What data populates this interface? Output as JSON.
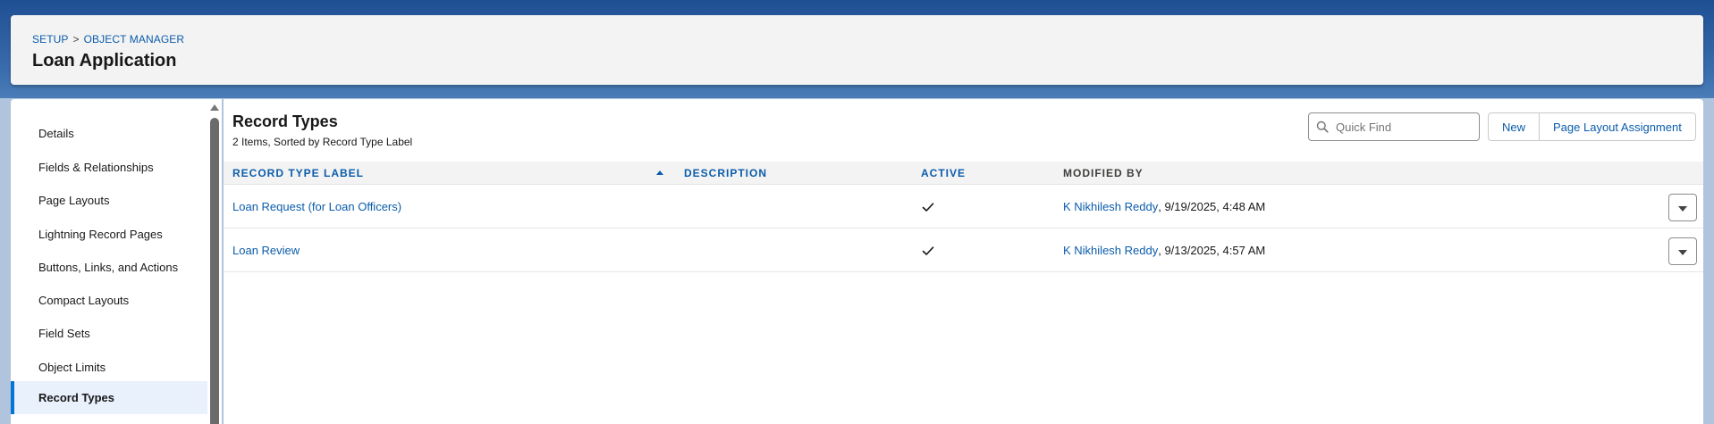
{
  "header": {
    "breadcrumb": [
      "SETUP",
      "OBJECT MANAGER"
    ],
    "breadcrumb_separator": ">",
    "title": "Loan Application"
  },
  "sidebar": {
    "items": [
      {
        "label": "Details"
      },
      {
        "label": "Fields & Relationships"
      },
      {
        "label": "Page Layouts"
      },
      {
        "label": "Lightning Record Pages"
      },
      {
        "label": "Buttons, Links, and Actions"
      },
      {
        "label": "Compact Layouts"
      },
      {
        "label": "Field Sets"
      },
      {
        "label": "Object Limits"
      },
      {
        "label": "Record Types",
        "active": true
      }
    ]
  },
  "main": {
    "title": "Record Types",
    "subtitle": "2 Items, Sorted by Record Type Label",
    "search": {
      "placeholder": "Quick Find",
      "value": ""
    },
    "buttons": {
      "new": "New",
      "page_layout_assignment": "Page Layout Assignment"
    },
    "table": {
      "columns": [
        "RECORD TYPE LABEL",
        "DESCRIPTION",
        "ACTIVE",
        "MODIFIED BY"
      ],
      "sorted_by": "RECORD TYPE LABEL",
      "rows": [
        {
          "label": "Loan Request (for Loan Officers)",
          "description": "",
          "active": true,
          "modified_by_user": "K Nikhilesh Reddy",
          "modified_by_date": ", 9/19/2025, 4:48 AM"
        },
        {
          "label": "Loan Review",
          "description": "",
          "active": true,
          "modified_by_user": "K Nikhilesh Reddy",
          "modified_by_date": ", 9/13/2025, 4:57 AM"
        }
      ]
    }
  },
  "colors": {
    "link": "#0b5cab",
    "active_nav_bg": "#e8f1fc",
    "brand_bar": "#0176d3"
  },
  "icons": {
    "search": "search-icon",
    "check": "check-icon",
    "row_menu": "chevron-down-icon"
  }
}
